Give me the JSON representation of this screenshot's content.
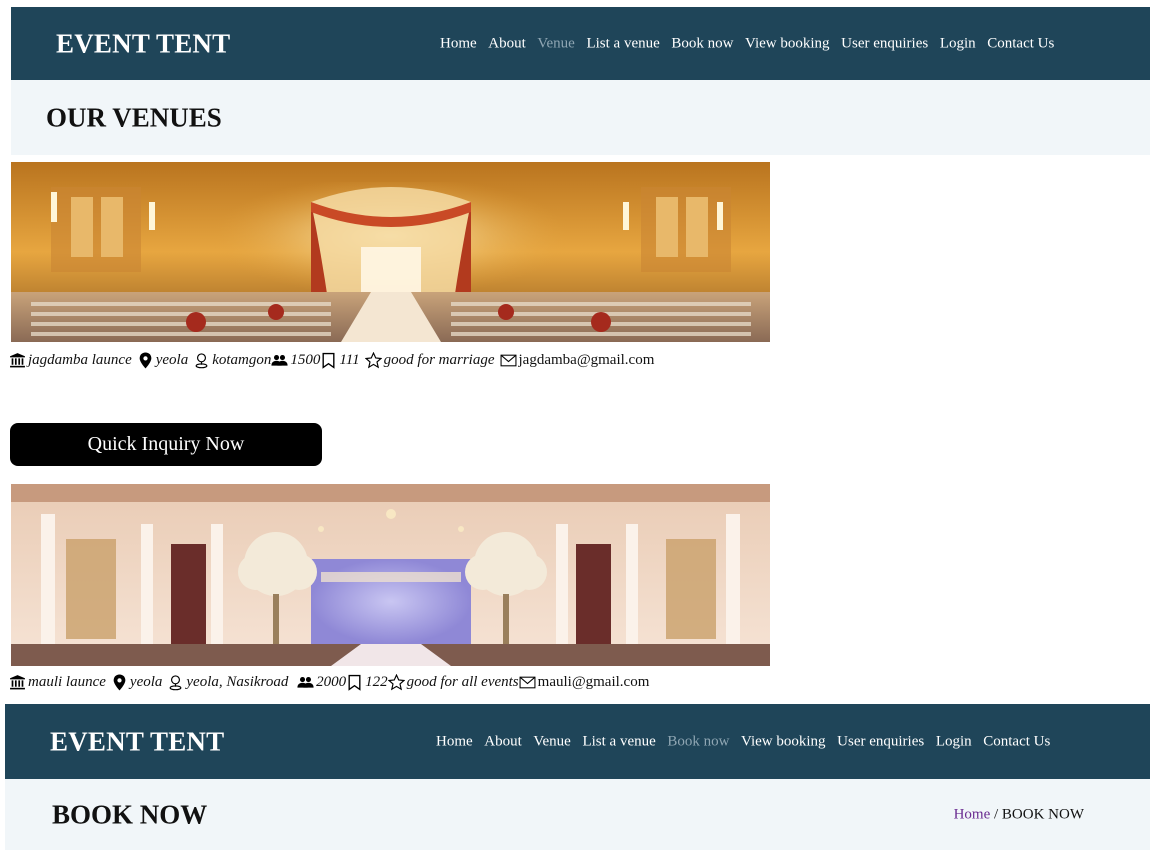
{
  "brand": "EVENT TENT",
  "nav_top": {
    "items": [
      "Home",
      "About",
      "Venue",
      "List a venue",
      "Book now",
      "View booking",
      "User enquiries",
      "Login",
      "Contact Us"
    ],
    "active": "Venue"
  },
  "nav_bottom": {
    "items": [
      "Home",
      "About",
      "Venue",
      "List a venue",
      "Book now",
      "View booking",
      "User enquiries",
      "Login",
      "Contact Us"
    ],
    "active": "Book now"
  },
  "section_venues": {
    "title": "OUR VENUES"
  },
  "venues": [
    {
      "name": "jagdamba launce",
      "city": "yeola",
      "area": "kotamgon",
      "capacity": "1500",
      "bookings": "111",
      "note": "good for marriage",
      "email": "jagdamba@gmail.com"
    },
    {
      "name": "mauli launce",
      "city": "yeola",
      "area": "yeola, Nasikroad ",
      "capacity": "2000",
      "bookings": "122",
      "note": "good for all events",
      "email": "mauli@gmail.com"
    }
  ],
  "quick_inquiry": {
    "label": "Quick Inquiry Now"
  },
  "section_book": {
    "title": "BOOK NOW",
    "breadcrumb_home": "Home",
    "breadcrumb_sep": " / ",
    "breadcrumb_current": "BOOK NOW"
  },
  "colors": {
    "navbar": "#1f4559",
    "band": "#f1f6f9",
    "active_nav": "#8fa6b3",
    "link": "#6a2c91"
  },
  "icons": {
    "venue": "bank-icon",
    "city": "location-pin-icon",
    "area": "map-pin-outline-icon",
    "capacity": "people-icon",
    "bookings": "bookmark-icon",
    "note": "star-icon",
    "email": "envelope-icon"
  }
}
